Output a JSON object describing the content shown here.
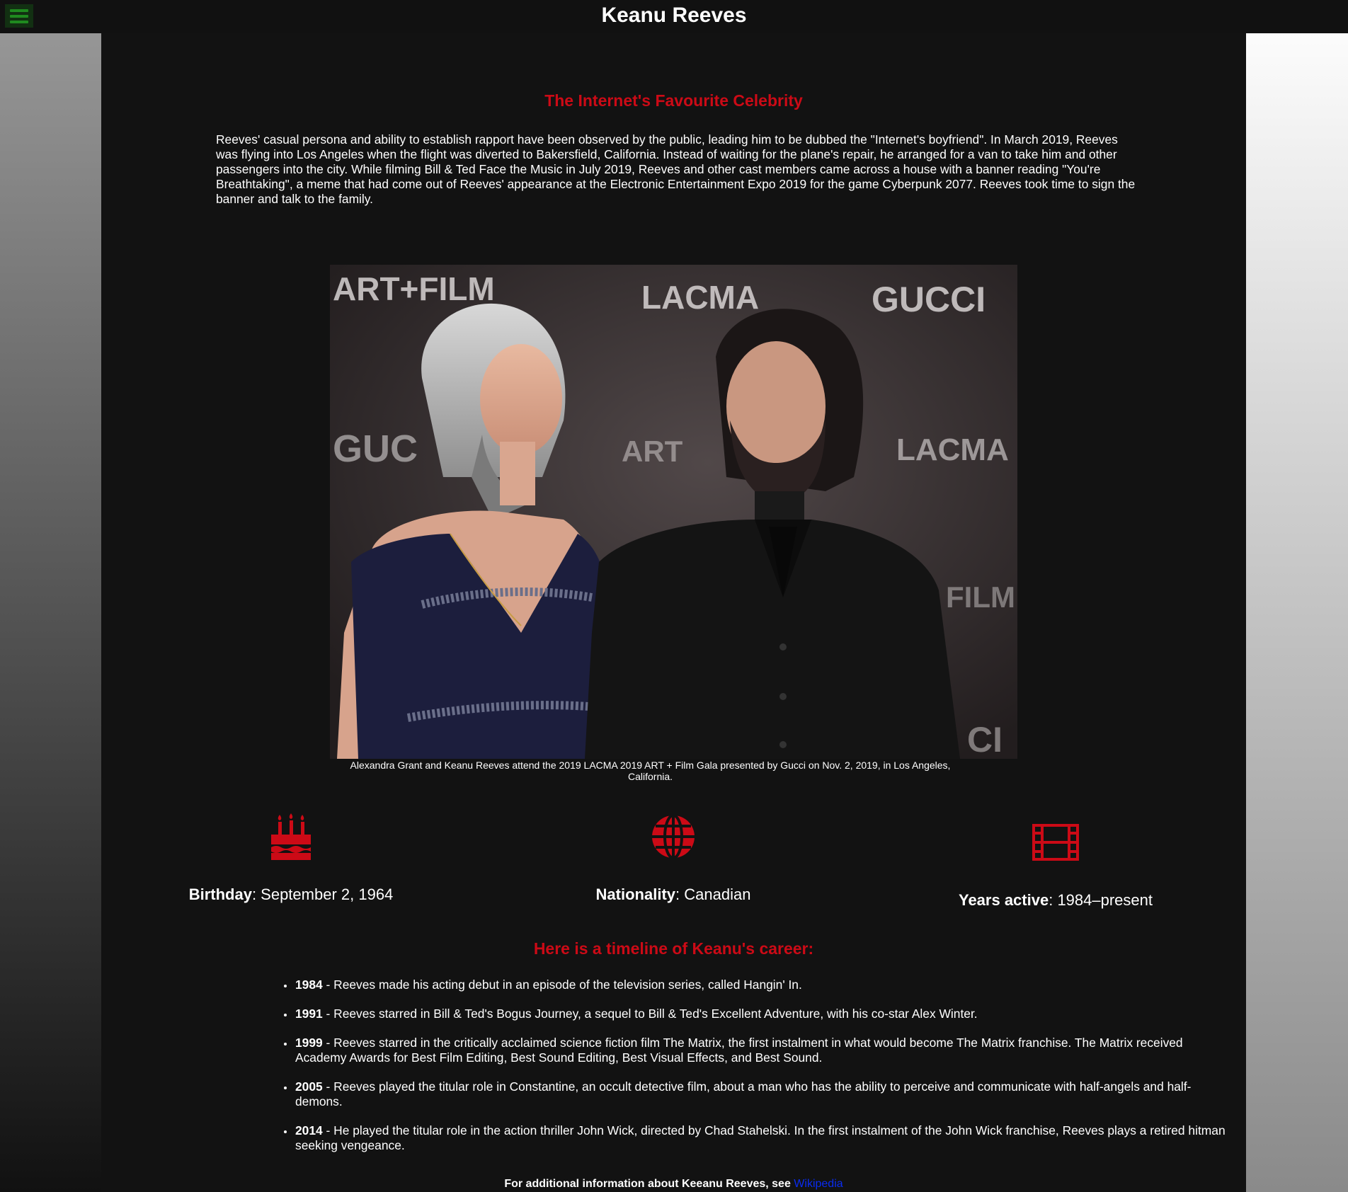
{
  "header": {
    "title": "Keanu Reeves",
    "menu_icon": "hamburger-menu-icon"
  },
  "colors": {
    "accent_red": "#cc0a16",
    "menu_green": "#1f8a1f",
    "link_blue": "#0a2cf2",
    "panel_bg": "#121212"
  },
  "intro": {
    "heading": "The Internet's Favourite Celebrity",
    "paragraph": "Reeves' casual persona and ability to establish rapport have been observed by the public, leading him to be dubbed the \"Internet's boyfriend\". In March 2019, Reeves was flying into Los Angeles when the flight was diverted to Bakersfield, California. Instead of waiting for the plane's repair, he arranged for a van to take him and other passengers into the city. While filming Bill & Ted Face the Music in July 2019, Reeves and other cast members came across a house with a banner reading \"You're Breathtaking\", a meme that had come out of Reeves' appearance at the Electronic Entertainment Expo 2019 for the game Cyberpunk 2077. Reeves took time to sign the banner and talk to the family."
  },
  "photo": {
    "backdrop_words": [
      "ART+FILM",
      "LACMA",
      "GUCCI",
      "GUC",
      "ART",
      "LACMA",
      "FILM",
      "CI"
    ],
    "caption": "Alexandra Grant and Keanu Reeves attend the 2019 LACMA 2019 ART + Film Gala presented by Gucci on Nov. 2, 2019, in Los Angeles, California."
  },
  "facts": [
    {
      "icon": "birthday-cake-icon",
      "label": "Birthday",
      "value": ": September 2, 1964"
    },
    {
      "icon": "globe-icon",
      "label": "Nationality",
      "value": ": Canadian"
    },
    {
      "icon": "film-icon",
      "label": "Years active",
      "value": ": 1984–present"
    }
  ],
  "timeline": {
    "heading": "Here is a timeline of Keanu's career:",
    "items": [
      {
        "year": "1984",
        "text": " - Reeves made his acting debut in an episode of the television series, called Hangin' In."
      },
      {
        "year": "1991",
        "text": " - Reeves starred in Bill & Ted's Bogus Journey, a sequel to Bill & Ted's Excellent Adventure, with his co-star Alex Winter."
      },
      {
        "year": "1999",
        "text": " - Reeves starred in the critically acclaimed science fiction film The Matrix, the first instalment in what would become The Matrix franchise. The Matrix received Academy Awards for Best Film Editing, Best Sound Editing, Best Visual Effects, and Best Sound."
      },
      {
        "year": "2005",
        "text": " - Reeves played the titular role in Constantine, an occult detective film, about a man who has the ability to perceive and communicate with half-angels and half-demons."
      },
      {
        "year": "2014",
        "text": " - He played the titular role in the action thriller John Wick, directed by Chad Stahelski. In the first instalment of the John Wick franchise, Reeves plays a retired hitman seeking vengeance."
      }
    ]
  },
  "footer": {
    "text": "For additional information about Keeanu Reeves, see ",
    "link_label": "Wikipedia"
  }
}
